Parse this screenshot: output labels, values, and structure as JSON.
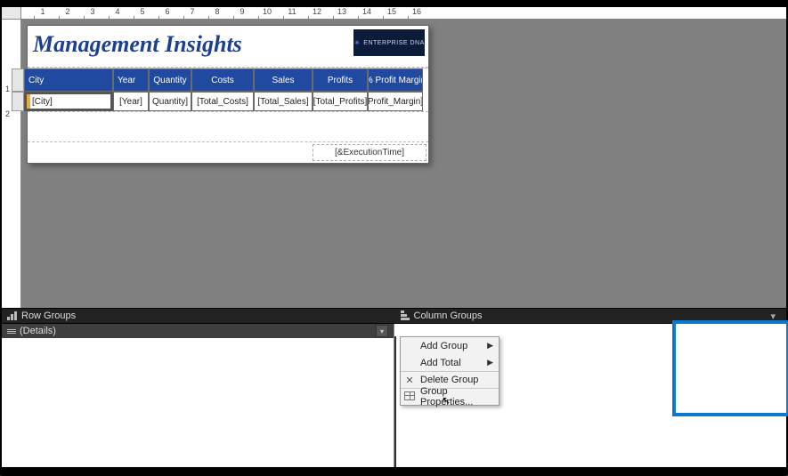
{
  "ruler": {
    "marks": [
      1,
      2,
      3,
      4,
      5,
      6,
      7,
      8,
      9,
      10,
      11,
      12,
      13,
      14,
      15,
      16
    ]
  },
  "vruler": {
    "marks": [
      1,
      2
    ]
  },
  "report": {
    "title": "Management Insights",
    "logo_text": "ENTERPRISE DNA",
    "footer_exec_time": "[&ExecutionTime]"
  },
  "tablix": {
    "headers": {
      "city": "City",
      "year": "Year",
      "quantity": "Quantity",
      "costs": "Costs",
      "sales": "Sales",
      "profits": "Profits",
      "profit_margin": "% Profit Margin"
    },
    "row": {
      "city": "[City]",
      "year": "[Year]",
      "quantity": "Quantity]",
      "costs": "[Total_Costs]",
      "sales": "[Total_Sales]",
      "profits": "[Total_Profits]",
      "profit_margin": "Profit_Margin]"
    }
  },
  "groups": {
    "row_groups_label": "Row Groups",
    "column_groups_label": "Column Groups",
    "details_label": "(Details)"
  },
  "context_menu": {
    "add_group": "Add Group",
    "add_total": "Add Total",
    "delete_group": "Delete Group",
    "group_properties": "Group Properties..."
  }
}
